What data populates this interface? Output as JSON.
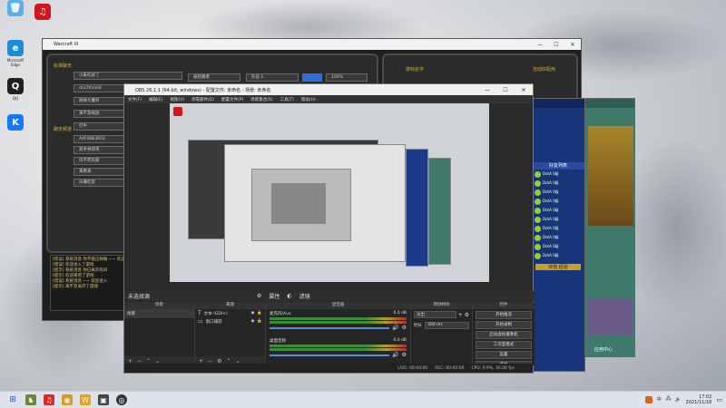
{
  "desktop_icons": [
    {
      "label": "",
      "icon": "recycle-bin-icon",
      "color": "#5ab0e8",
      "glyph": "🗑"
    },
    {
      "label": "",
      "icon": "netease-music-icon",
      "color": "#d0161e",
      "glyph": "♫"
    },
    {
      "label": "Microsoft Edge",
      "icon": "edge-icon",
      "color": "#1a8fd8",
      "glyph": "e"
    },
    {
      "label": "QQ",
      "icon": "qq-icon",
      "color": "#202020",
      "glyph": "Q"
    },
    {
      "label": "",
      "icon": "kugou-icon",
      "color": "#1677ff",
      "glyph": "K"
    }
  ],
  "game": {
    "title": "Warcraft III",
    "left_buttons": [
      "小朱吃屎了",
      "dra7thnold",
      "随缘大魔导",
      "来不及喝酒",
      "打牛"
    ],
    "chat_buttons": [
      "A4F46B3653",
      "高手林哥哥",
      "玩不死的家",
      "来看来",
      "乐嘴吃饭"
    ],
    "top_fields": [
      "被招募者",
      "队伍 1",
      "100%"
    ],
    "label_top_left": "标准聊天",
    "label_mid_left": "聊天频道",
    "label_top_right": "游戏名字",
    "label_right": "自动匹配用",
    "chat_log": [
      "[错误] 系统消息 你不能这样做 ~~ 欢迎回来",
      "[错误] 欢迎进入了游戏",
      "[提示] 系统消息 你已离开房间",
      "[提示] 欢迎来到了游戏",
      "[错误] 系统消息 ~~ 欢迎进入",
      "[提示] 来不及离开了游戏"
    ]
  },
  "obs": {
    "title": "OBS 26.1.1 (64-bit, windows) - 配置文件: 未命名 - 场景: 未命名",
    "menu": [
      "文件(F)",
      "编辑(E)",
      "视图(V)",
      "停靠部件(D)",
      "配置文件(P)",
      "场景集合(S)",
      "工具(T)",
      "帮助(H)"
    ],
    "no_source": "未选择源",
    "props_btn": "属性",
    "filter_btn": "滤镜",
    "docks": {
      "scenes": "场景",
      "sources": "来源",
      "mixer": "混音器",
      "transitions": "转场特效",
      "controls": "控件"
    },
    "scene_item": "场景",
    "source_items": [
      "文本 (GDI+)",
      "窗口捕获"
    ],
    "mixer_items": [
      {
        "name": "麦克风/Aux",
        "db": "0.0 dB"
      },
      {
        "name": "桌面音频",
        "db": "0.0 dB"
      }
    ],
    "transition": "淡出",
    "duration_label": "时长",
    "duration_value": "300 ms",
    "controls": [
      "开始推流",
      "开始录制",
      "启动虚拟摄像机",
      "工作室模式",
      "设置",
      "退出"
    ],
    "status": {
      "live": "LIVE: 00:00:00",
      "rec": "REC: 00:00:00",
      "cpu": "CPU: 0.9%, 30.00 fps"
    }
  },
  "qq": {
    "header": "好友列表",
    "rows": [
      "DotA 0级",
      "DotA 0级",
      "DotA 0级",
      "DotA 0级",
      "DotA 0级",
      "DotA 0级",
      "DotA 0级",
      "DotA 0级",
      "DotA 0级",
      "DotA 0级"
    ],
    "badge": "双倍 经验",
    "footer": "应用中心"
  },
  "taskbar": {
    "ime": "中",
    "time": "17:02",
    "date": "2021/11/18"
  }
}
